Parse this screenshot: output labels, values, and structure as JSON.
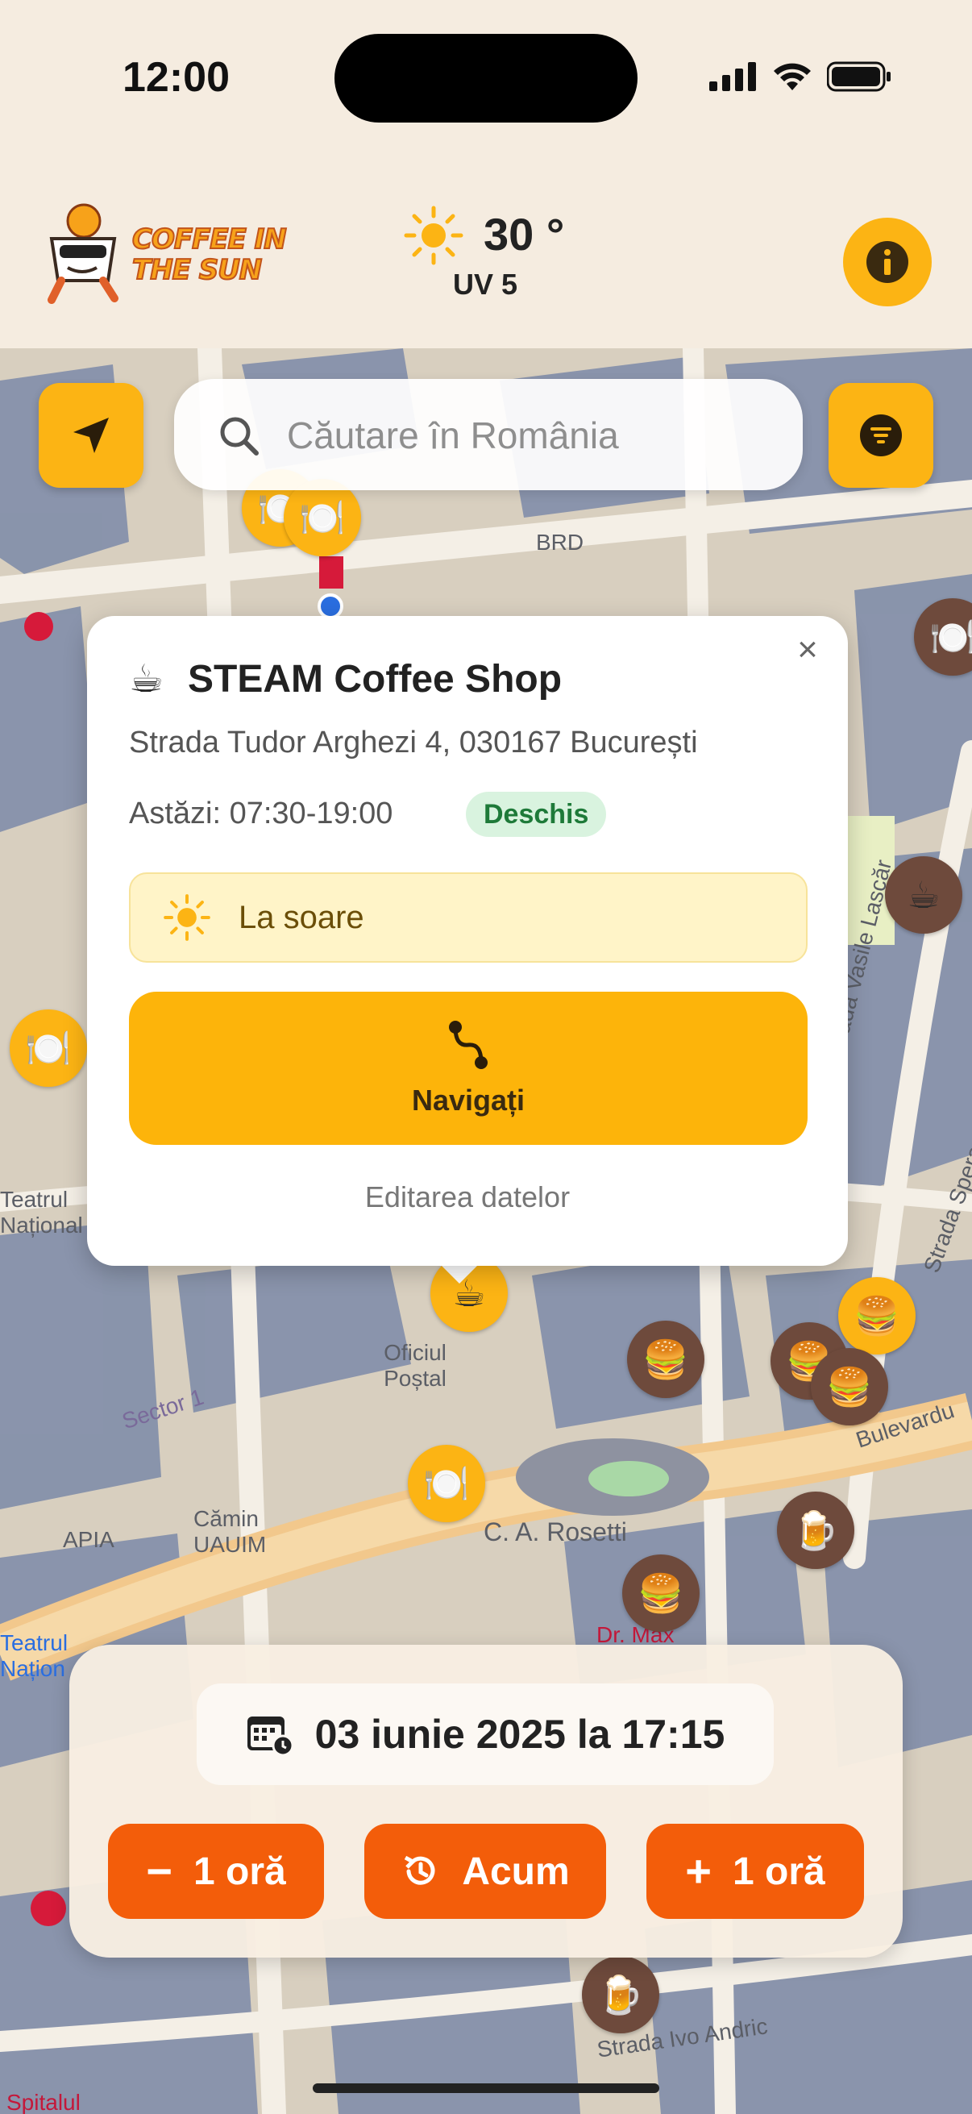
{
  "status_bar": {
    "time": "12:00"
  },
  "header": {
    "logo_text_line1": "COFFEE IN",
    "logo_text_line2": "THE SUN",
    "temperature": "30 °",
    "uv": "UV 5",
    "info_icon": "info-icon"
  },
  "search": {
    "placeholder": "Căutare în România"
  },
  "map_labels": {
    "brd": "BRD",
    "posta": "Oficiul Poștal",
    "rosetti": "C. A. Rosetti",
    "apia": "APIA",
    "camin": "Cămin UAUIM",
    "teatrul": "Teatrul Național",
    "teatrul_small": "Teatrul Națion",
    "drmax": "Dr. Max",
    "vasile": "Strada Vasile Lascăr",
    "spatul": "Spitalul",
    "andric": "Strada Ivo Andric",
    "bulevardul": "Bulevardu",
    "sector": "Sector 1",
    "spera": "Strada Spera"
  },
  "popup": {
    "icon": "coffee-cup",
    "title": "STEAM Coffee Shop",
    "address": "Strada Tudor Arghezi 4, 030167 București",
    "hours": "Astăzi: 07:30-19:00",
    "status_badge": "Deschis",
    "sun_status": "La soare",
    "navigate_label": "Navigați",
    "edit_label": "Editarea datelor",
    "close": "×"
  },
  "time_panel": {
    "date_label": "03 iunie 2025 la 17:15",
    "minus_label": "1 oră",
    "now_label": "Acum",
    "plus_label": "1 oră"
  },
  "colors": {
    "accent": "#fcb414",
    "primary_button": "#f35d0a",
    "open_badge_bg": "#d9f3df",
    "sun_status_bg": "#fff4c8"
  }
}
